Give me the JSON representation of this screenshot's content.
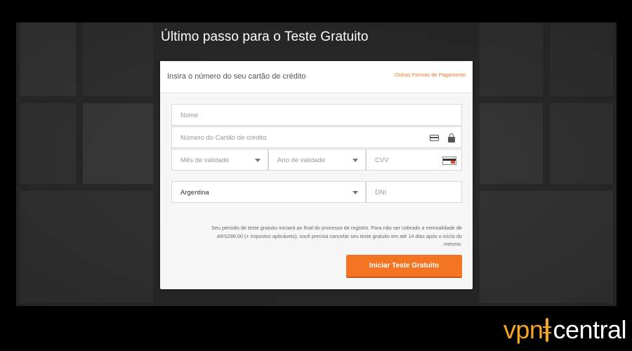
{
  "page": {
    "title": "Último passo para o Teste Gratuito"
  },
  "card": {
    "instruction": "Insira o número do seu cartão de crédito",
    "alt_payment_link": "Outras Formas de Pagamento"
  },
  "form": {
    "name_placeholder": "Nome",
    "card_number_placeholder": "Número do Cartão de crédito",
    "exp_month_placeholder": "Mês de validade",
    "exp_year_placeholder": "Ano de validade",
    "cvv_placeholder": "CVV",
    "country_value": "Argentina",
    "dni_placeholder": "DNI"
  },
  "disclaimer": "Seu período de teste gratuito iniciará ao final do processo de registro. Para não ser cobrado a mensalidade de ARS299.00 (+ impostos aplicáveis), você precisa cancelar seu teste gratuito em até 14 dias após o início do mesmo.",
  "cta_label": "Iniciar Teste Gratuito",
  "watermark": {
    "part1": "vpn",
    "part2": "central"
  },
  "colors": {
    "accent": "#f47521",
    "watermark_orange": "#f5a623"
  },
  "icons": [
    "credit-card-icon",
    "lock-icon",
    "cvv-card-icon",
    "chevron-down-icon"
  ]
}
